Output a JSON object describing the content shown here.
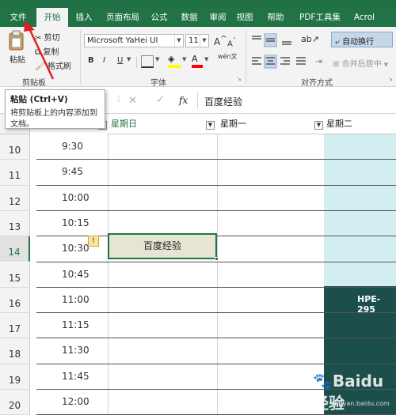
{
  "menu_tabs": [
    "文件",
    "开始",
    "插入",
    "页面布局",
    "公式",
    "数据",
    "审阅",
    "视图",
    "帮助",
    "PDF工具集",
    "Acrol"
  ],
  "clipboard": {
    "paste": "粘贴",
    "cut": "剪切",
    "copy": "复制",
    "format_painter": "格式刷",
    "group": "剪贴板"
  },
  "font": {
    "name": "Microsoft YaHei UI",
    "size": "11",
    "grow": "A",
    "shrink": "A",
    "bold": "B",
    "italic": "I",
    "underline": "U",
    "pinyin": "wén文",
    "group": "字体"
  },
  "alignment": {
    "wrap": "自动换行",
    "merge": "合并后居中",
    "group": "对齐方式"
  },
  "tooltip": {
    "title": "粘贴 (Ctrl+V)",
    "desc": "将剪贴板上的内容添加到文档。"
  },
  "formula_bar": {
    "fx": "fx",
    "content": "百度经验"
  },
  "columns": [
    "星期日",
    "星期一",
    "星期二"
  ],
  "rows": [
    {
      "num": "10",
      "time": "9:30"
    },
    {
      "num": "11",
      "time": "9:45"
    },
    {
      "num": "12",
      "time": "10:00"
    },
    {
      "num": "13",
      "time": "10:15"
    },
    {
      "num": "14",
      "time": "10:30"
    },
    {
      "num": "15",
      "time": "10:45"
    },
    {
      "num": "16",
      "time": "11:00"
    },
    {
      "num": "17",
      "time": "11:15"
    },
    {
      "num": "18",
      "time": "11:30"
    },
    {
      "num": "19",
      "time": "11:45"
    },
    {
      "num": "20",
      "time": "12:00"
    }
  ],
  "selected_cell_text": "百度经验",
  "event_text": "HPE-295",
  "warning_badge": "!",
  "watermark": "Baidu经验",
  "watermark_url": "jingyan.baidu.com",
  "colors": {
    "excel_green": "#217346",
    "teal_light": "#d3eef0",
    "teal_dark": "#1c4f4c",
    "cell_fill": "#e6e4d3"
  }
}
